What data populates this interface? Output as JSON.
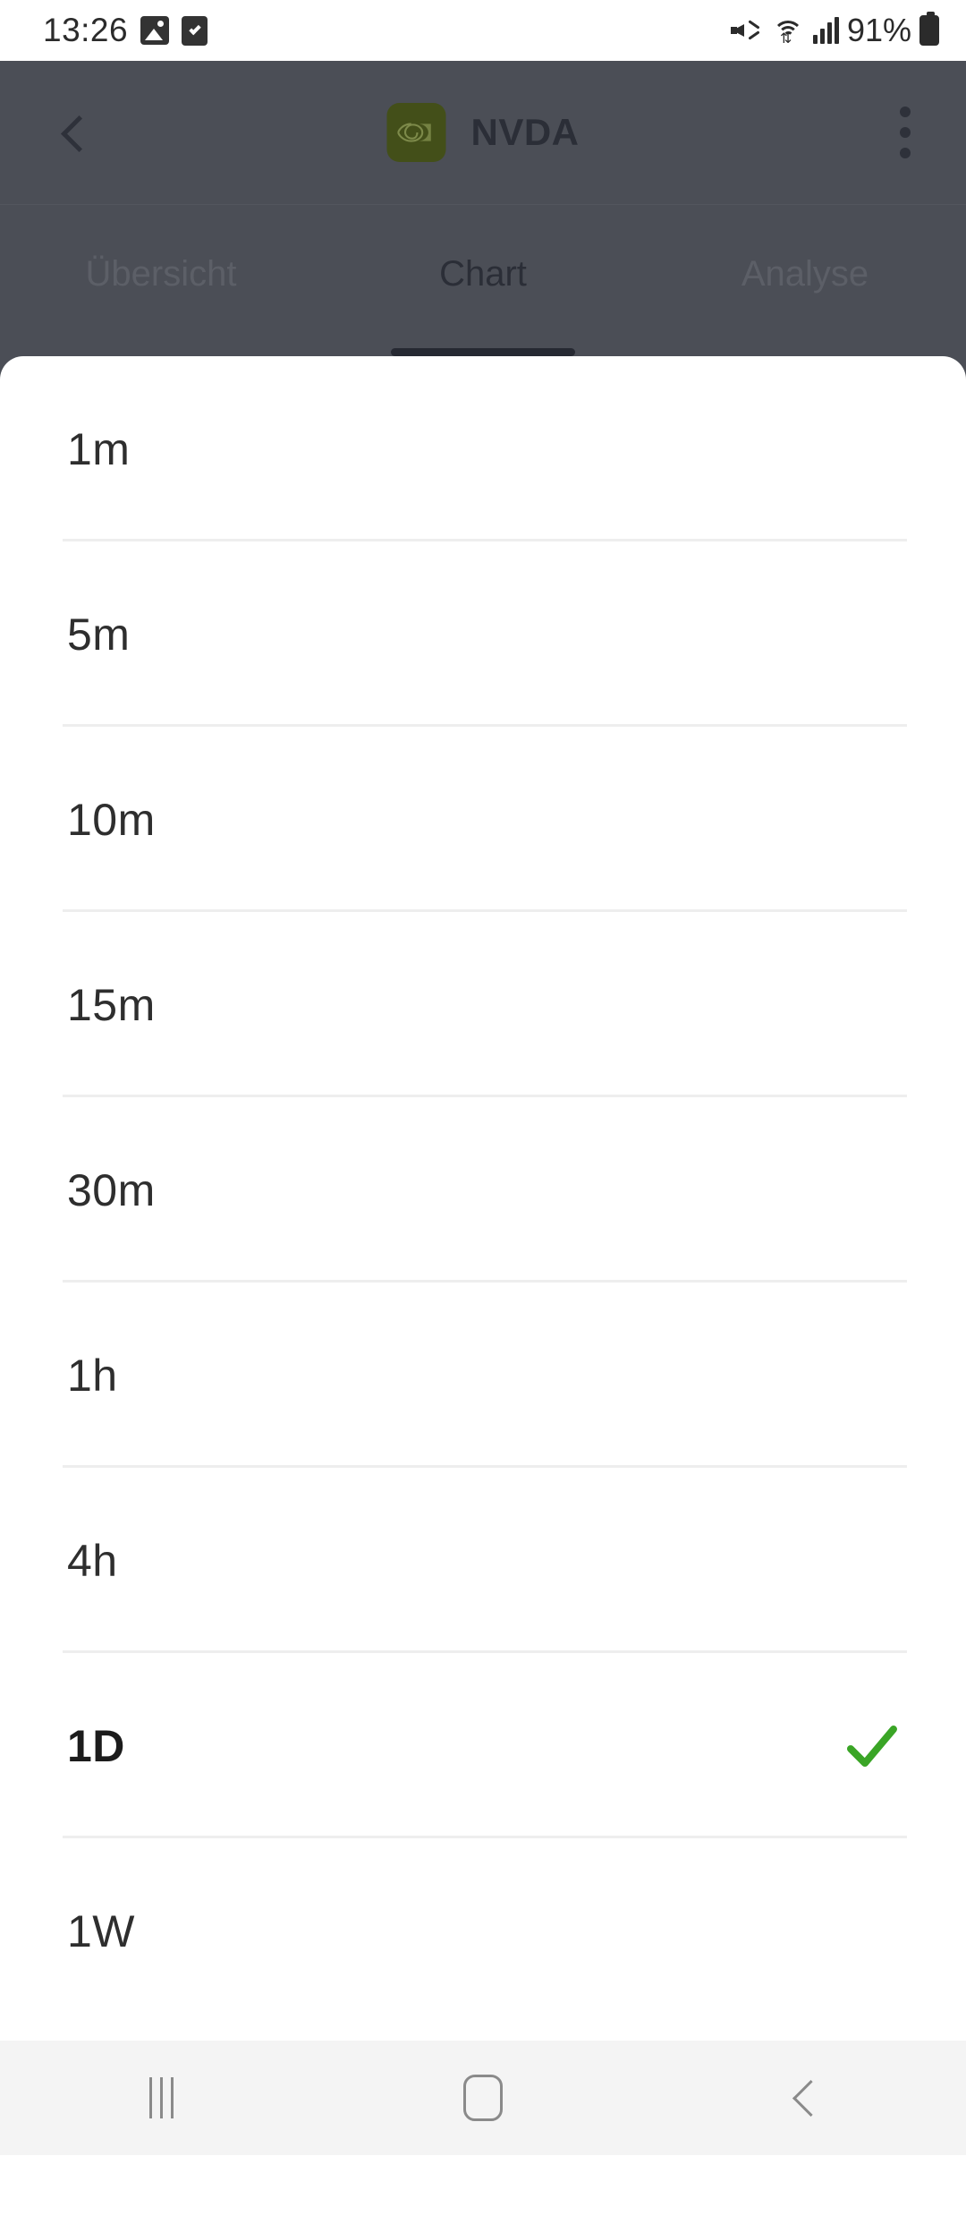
{
  "status_bar": {
    "time": "13:26",
    "battery_percent": "91%",
    "left_icons": [
      "gallery-icon",
      "task-checkbox-icon"
    ],
    "right_icons": [
      "mute-icon",
      "wifi-icon",
      "cellular-signal-icon",
      "battery-icon"
    ]
  },
  "app_bar": {
    "back_label": "back-chevron-icon",
    "logo": "nvidia-logo-icon",
    "title": "NVDA",
    "overflow_label": "overflow-menu-icon",
    "background_color": "#4b4e56"
  },
  "tabs": {
    "items": [
      {
        "label": "Übersicht",
        "active": false
      },
      {
        "label": "Chart",
        "active": true
      },
      {
        "label": "Analyse",
        "active": false
      }
    ]
  },
  "interval_sheet": {
    "selected": "1D",
    "check_color": "#3aa526",
    "options": [
      {
        "label": "1m",
        "selected": false,
        "last": false
      },
      {
        "label": "5m",
        "selected": false,
        "last": false
      },
      {
        "label": "10m",
        "selected": false,
        "last": false
      },
      {
        "label": "15m",
        "selected": false,
        "last": false
      },
      {
        "label": "30m",
        "selected": false,
        "last": false
      },
      {
        "label": "1h",
        "selected": false,
        "last": false
      },
      {
        "label": "4h",
        "selected": false,
        "last": false
      },
      {
        "label": "1D",
        "selected": true,
        "last": false
      },
      {
        "label": "1W",
        "selected": false,
        "last": true
      }
    ]
  },
  "nav_bar": {
    "recents_label": "recents-icon",
    "home_label": "home-icon",
    "back_label": "back-icon"
  }
}
